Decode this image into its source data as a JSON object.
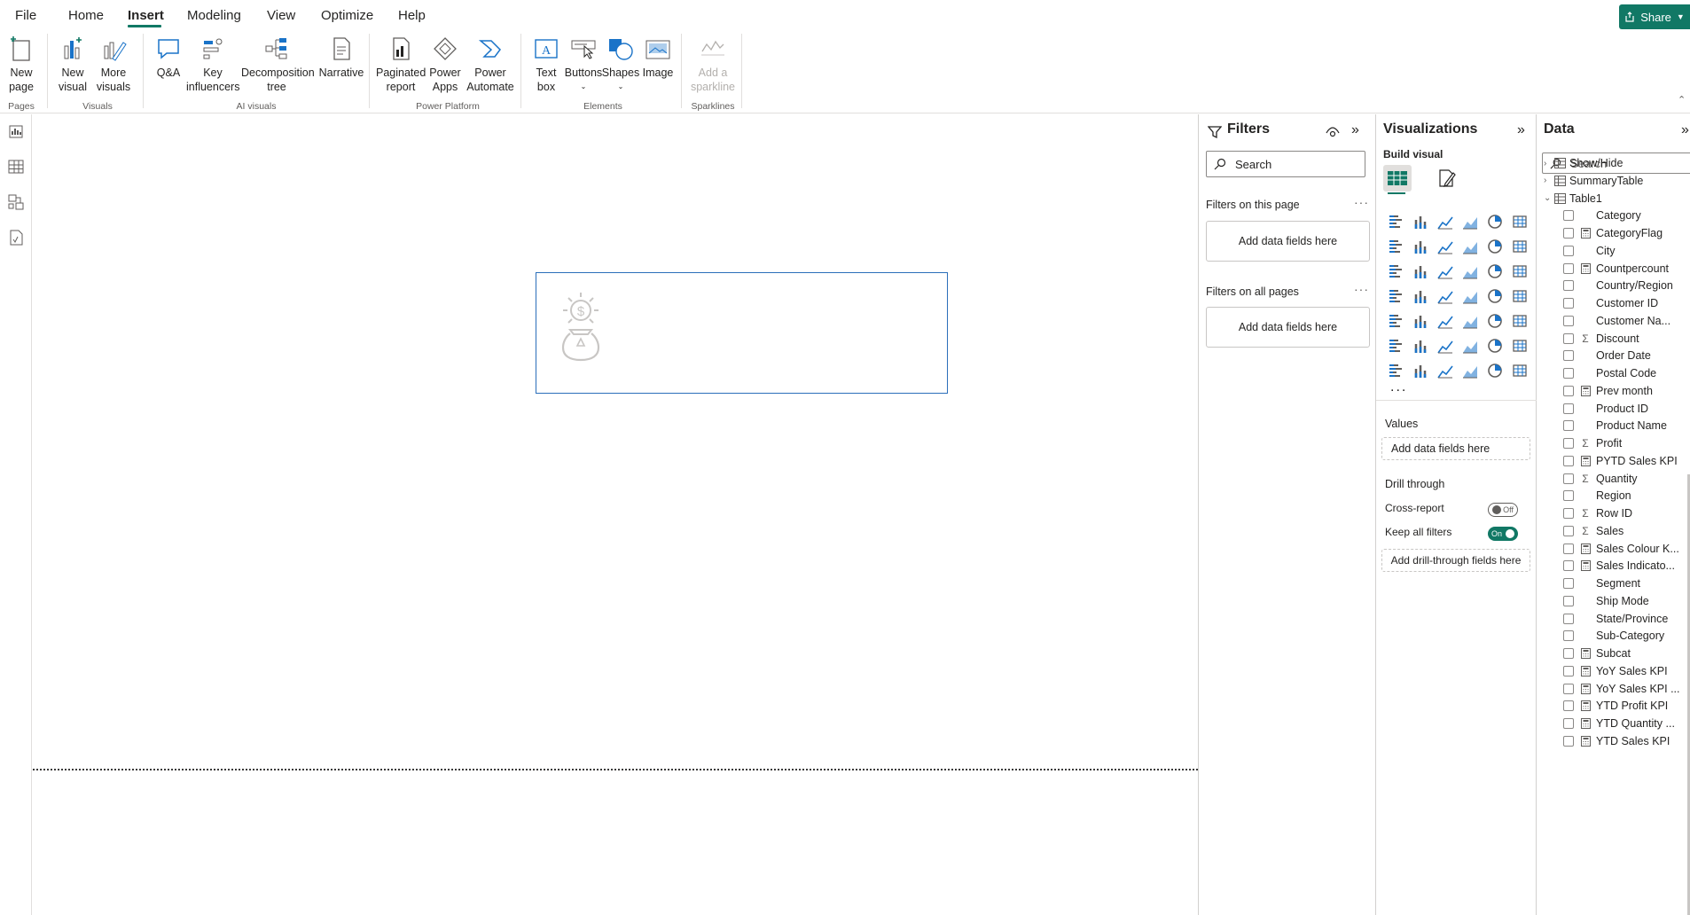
{
  "menu": {
    "items": [
      "File",
      "Home",
      "Insert",
      "Modeling",
      "View",
      "Optimize",
      "Help"
    ],
    "active": "Insert",
    "share_label": "Share"
  },
  "ribbon": {
    "new_page": "New page",
    "new_visual": "New visual",
    "more_visuals": "More visuals",
    "pages_group": "Pages",
    "visuals_group": "Visuals",
    "qa": "Q&A",
    "key_influencers": "Key influencers",
    "decomposition_tree": "Decomposition tree",
    "narrative": "Narrative",
    "ai_group": "AI visuals",
    "paginated_report": "Paginated report",
    "power_apps": "Power Apps",
    "power_automate": "Power Automate",
    "power_platform_group": "Power Platform",
    "text_box": "Text box",
    "buttons": "Buttons",
    "shapes": "Shapes",
    "image": "Image",
    "elements_group": "Elements",
    "add_sparkline": "Add a sparkline",
    "sparklines_group": "Sparklines"
  },
  "filters": {
    "title": "Filters",
    "search_placeholder": "Search",
    "on_this_page": "Filters on this page",
    "on_all_pages": "Filters on all pages",
    "add_fields": "Add data fields here"
  },
  "visualizations": {
    "title": "Visualizations",
    "build_visual": "Build visual",
    "values_label": "Values",
    "values_well": "Add data fields here",
    "drill_through": "Drill through",
    "cross_report": "Cross-report",
    "cross_report_state": "Off",
    "keep_all_filters": "Keep all filters",
    "keep_all_filters_state": "On",
    "drill_well": "Add drill-through fields here",
    "more": "..."
  },
  "data": {
    "title": "Data",
    "search_placeholder": "Search",
    "tables": [
      {
        "name": "Show/Hide",
        "expanded": false
      },
      {
        "name": "SummaryTable",
        "expanded": false
      },
      {
        "name": "Table1",
        "expanded": true
      }
    ],
    "fields": [
      {
        "name": "Category",
        "icon": ""
      },
      {
        "name": "CategoryFlag",
        "icon": "calc"
      },
      {
        "name": "City",
        "icon": ""
      },
      {
        "name": "Countpercount",
        "icon": "calc"
      },
      {
        "name": "Country/Region",
        "icon": ""
      },
      {
        "name": "Customer ID",
        "icon": ""
      },
      {
        "name": "Customer Na...",
        "icon": ""
      },
      {
        "name": "Discount",
        "icon": "sigma"
      },
      {
        "name": "Order Date",
        "icon": ""
      },
      {
        "name": "Postal Code",
        "icon": ""
      },
      {
        "name": "Prev month",
        "icon": "calc"
      },
      {
        "name": "Product ID",
        "icon": ""
      },
      {
        "name": "Product Name",
        "icon": ""
      },
      {
        "name": "Profit",
        "icon": "sigma"
      },
      {
        "name": "PYTD Sales KPI",
        "icon": "calc"
      },
      {
        "name": "Quantity",
        "icon": "sigma"
      },
      {
        "name": "Region",
        "icon": ""
      },
      {
        "name": "Row ID",
        "icon": "sigma"
      },
      {
        "name": "Sales",
        "icon": "sigma"
      },
      {
        "name": "Sales Colour K...",
        "icon": "calc"
      },
      {
        "name": "Sales Indicato...",
        "icon": "calc"
      },
      {
        "name": "Segment",
        "icon": ""
      },
      {
        "name": "Ship Mode",
        "icon": ""
      },
      {
        "name": "State/Province",
        "icon": ""
      },
      {
        "name": "Sub-Category",
        "icon": ""
      },
      {
        "name": "Subcat",
        "icon": "calc"
      },
      {
        "name": "YoY Sales KPI",
        "icon": "calc"
      },
      {
        "name": "YoY Sales KPI ...",
        "icon": "calc"
      },
      {
        "name": "YTD Profit KPI",
        "icon": "calc"
      },
      {
        "name": "YTD Quantity ...",
        "icon": "calc"
      },
      {
        "name": "YTD Sales KPI",
        "icon": "calc"
      }
    ]
  },
  "colors": {
    "accent": "#117865",
    "visual_border": "#2b6fba",
    "ribbon_icon_blue": "#1a73c8"
  }
}
